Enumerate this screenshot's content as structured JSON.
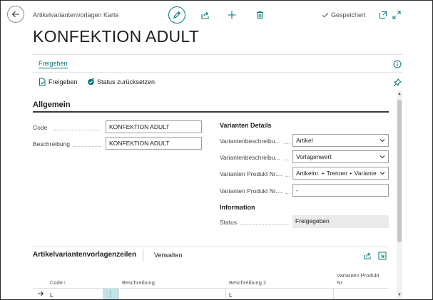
{
  "header": {
    "breadcrumb": "Artikelvariantenvorlagen Karte",
    "saved_status": "Gespeichert",
    "title": "KONFEKTION ADULT"
  },
  "actionbar": {
    "tab_label": "Freigeben",
    "actions": [
      {
        "label": "Freigeben",
        "icon": "release-document-icon"
      },
      {
        "label": "Status zurücksetzen",
        "icon": "reopen-icon"
      }
    ]
  },
  "general": {
    "section_title": "Allgemein",
    "fields": [
      {
        "label": "Code",
        "value": "KONFEKTION ADULT"
      },
      {
        "label": "Beschreibung",
        "value": "KONFEKTION ADULT"
      }
    ]
  },
  "variant_details": {
    "heading": "Varianten Details",
    "fields": [
      {
        "label": "Variantenbeschreibu...",
        "value": "Artikel",
        "type": "select"
      },
      {
        "label": "Variantenbeschreibu...",
        "value": "Vorlagenwert",
        "type": "select"
      },
      {
        "label": "Varianten Produkt Nr....",
        "value": "Artikelnr. + Trenner + Variante",
        "type": "select"
      },
      {
        "label": "Varianten Produkt Nr....",
        "value": "-",
        "type": "input"
      }
    ]
  },
  "information": {
    "heading": "Information",
    "status_label": "Status",
    "status_value": "Freigegeben"
  },
  "lines": {
    "title": "Artikelvariantenvorlagenzeilen",
    "manage_label": "Verwalten",
    "columns": [
      "Code",
      "Beschreibung",
      "Beschreibung 2",
      "Varianten Produkt Nr."
    ],
    "sort_indicator": "↑",
    "rows": [
      {
        "code": "L",
        "beschreibung": "",
        "beschreibung2": "L",
        "varianten_produkt_nr": ""
      }
    ]
  },
  "colors": {
    "accent": "#00787a",
    "menu_cell": "#bfe3e6",
    "readonly_bg": "#eaeaea"
  }
}
